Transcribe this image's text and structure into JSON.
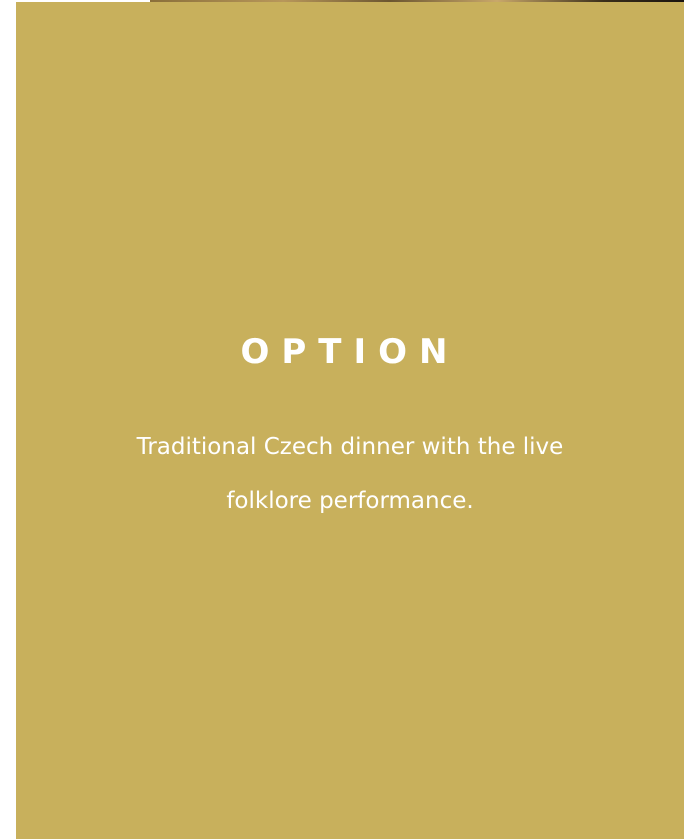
{
  "card": {
    "title": "OPTION",
    "description": "Traditional Czech dinner with the live folklore performance.",
    "background_color": "#c8b05c",
    "text_color": "#ffffff"
  }
}
